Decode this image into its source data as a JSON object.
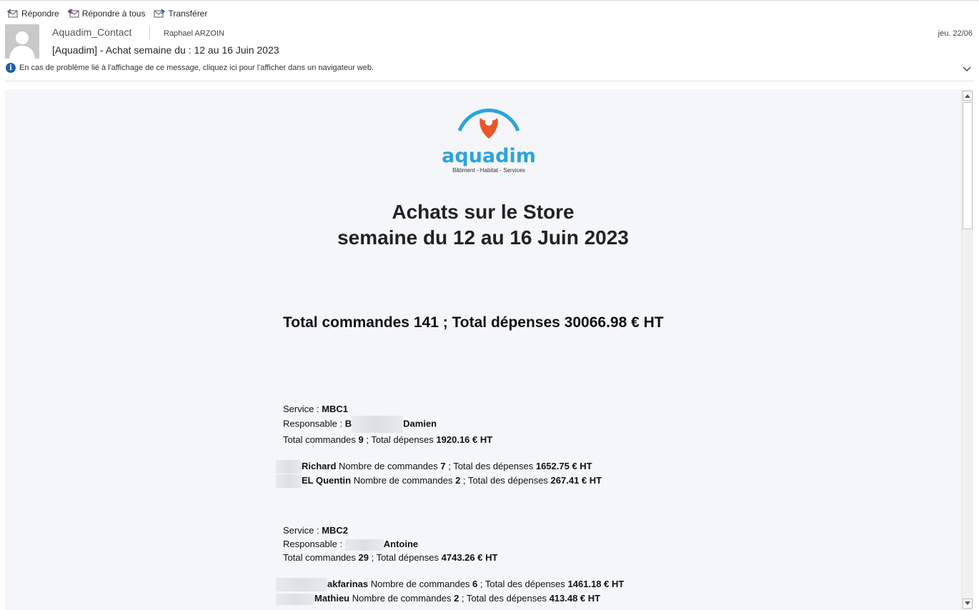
{
  "toolbar": {
    "reply_label": "Répondre",
    "reply_all_label": "Répondre à tous",
    "forward_label": "Transférer"
  },
  "header": {
    "from": "Aquadim_Contact",
    "to": "Raphael ARZOIN",
    "date": "jeu. 22/06",
    "subject": "[Aquadim] - Achat semaine du : 12 au 16 Juin 2023",
    "info_text": "En cas de problème lié à l'affichage de ce message, cliquez ici pour l'afficher dans un navigateur web."
  },
  "logo": {
    "brand": "aquadim",
    "tagline": "Bâtiment - Habitat - Services"
  },
  "email": {
    "title_line1": "Achats sur le Store",
    "title_line2": "semaine du 12 au 16 Juin 2023",
    "totals": "Total commandes 141 ; Total dépenses 30066.98 € HT"
  },
  "services": [
    {
      "service_label": "Service : ",
      "service_name": "MBC1",
      "resp_label": "Responsable : ",
      "resp_prefix": "B",
      "resp_name": "Damien",
      "total_prefix": "Total commandes ",
      "total_orders": "9",
      "total_mid": " ; Total dépenses ",
      "total_spend": "1920.16 € HT",
      "employees": [
        {
          "name": "Richard",
          "orders_label": " Nombre de commandes ",
          "orders": "7",
          "spend_label": " ; Total des dépenses ",
          "spend": "1652.75 € HT"
        },
        {
          "name": "EL Quentin",
          "orders_label": " Nombre de commandes ",
          "orders": "2",
          "spend_label": " ; Total des dépenses ",
          "spend": "267.41 € HT"
        }
      ]
    },
    {
      "service_label": "Service : ",
      "service_name": "MBC2",
      "resp_label": "Responsable : ",
      "resp_prefix": "",
      "resp_name": "Antoine",
      "total_prefix": "Total commandes ",
      "total_orders": "29",
      "total_mid": " ; Total dépenses ",
      "total_spend": "4743.26 € HT",
      "employees": [
        {
          "name": "akfarinas",
          "orders_label": " Nombre de commandes ",
          "orders": "6",
          "spend_label": " ; Total des dépenses ",
          "spend": "1461.18 € HT"
        },
        {
          "name": "Mathieu",
          "orders_label": " Nombre de commandes ",
          "orders": "2",
          "spend_label": " ; Total des dépenses ",
          "spend": "413.48 € HT"
        }
      ]
    }
  ],
  "icons": {
    "reply": "reply-icon",
    "reply_all": "reply-all-icon",
    "forward": "forward-icon",
    "info": "info-icon",
    "expand": "chevron-down-icon"
  },
  "colors": {
    "brand_blue": "#2aa4dc",
    "brand_orange": "#e8562a",
    "info_blue": "#1f5fa8"
  }
}
